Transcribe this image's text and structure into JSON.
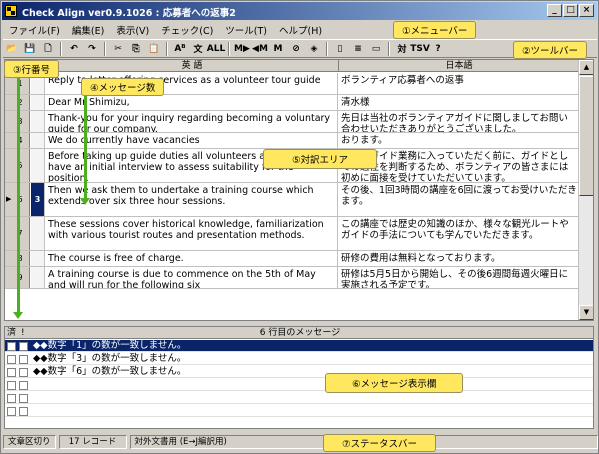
{
  "window": {
    "title": "Check Align ver0.9.1026 : 応募者への返事2",
    "minimize": "_",
    "maximize": "□",
    "close": "×"
  },
  "menu": [
    "ファイル(F)",
    "編集(E)",
    "表示(V)",
    "チェック(C)",
    "ツール(T)",
    "ヘルプ(H)"
  ],
  "toolbar": {
    "icons": [
      "open-icon",
      "save-icon",
      "new-icon",
      "undo-icon",
      "redo-icon",
      "cut-icon",
      "copy-icon",
      "paste-icon",
      "font-icon",
      "text-icon",
      "check-all-icon",
      "next-msg-icon",
      "prev-msg-icon",
      "msg-icon",
      "delete-msg-icon",
      "highlight-icon",
      "split-icon",
      "merge-icon",
      "line-icon",
      "parallel-icon",
      "tsv-icon",
      "help-icon"
    ],
    "glyphs": [
      "📂",
      "💾",
      "🗋",
      "↶",
      "↷",
      "✂",
      "⎘",
      "📋",
      "Aᴮ",
      "文",
      "ALL",
      "M▶",
      "◀M",
      "M",
      "⊘",
      "◈",
      "▯",
      "≡",
      "▭",
      "対",
      "TSV",
      "?"
    ]
  },
  "callouts": {
    "menubar": "①メニューバー",
    "toolbar": "②ツールバー",
    "line_number": "③行番号",
    "message_count": "④メッセージ数",
    "translation_area": "⑤対訳エリア",
    "message_area": "⑥メッセージ表示欄",
    "status_bar": "⑦ステータスバー"
  },
  "grid": {
    "col_en": "英 語",
    "col_ja": "日本語",
    "rows": [
      {
        "num": "1",
        "msg": "",
        "en": "Reply to letter offering services as a volunteer tour guide",
        "ja": "ボランティア応募者への返事"
      },
      {
        "num": "2",
        "msg": "",
        "en": "Dear Mr Shimizu,",
        "ja": "清水様"
      },
      {
        "num": "3",
        "msg": "",
        "en": "Thank-you for your inquiry regarding becoming a voluntary guide for our company.",
        "ja": "先日は当社のボランティアガイドに関しましてお問い合わせいただきありがとうございました。"
      },
      {
        "num": "4",
        "msg": "",
        "en": "We do currently have vacancies",
        "ja": "おります。"
      },
      {
        "num": "5",
        "msg": "",
        "en": "Before taking up guide duties all volunteers are required to have an initial interview to assess suitability for the position.",
        "ja": "実際のガイド業務に入っていただく前に、ガイドとしての適性を判断するため、ボランティアの皆さまには初めに面接を受けていただいています。"
      },
      {
        "num": "6",
        "msg": "3",
        "en": "Then we ask them to undertake a training course which extends over six three hour sessions.",
        "ja": "その後、1回3時間の講座を6回に渡ってお受けいただきます。"
      },
      {
        "num": "7",
        "msg": "",
        "en": "These sessions cover historical knowledge, familiarization with various tourist routes and presentation methods.",
        "ja": "この講座では歴史の知識のほか、様々な観光ルートやガイドの手法についても学んでいただきます。"
      },
      {
        "num": "8",
        "msg": "",
        "en": "The course is free of charge.",
        "ja": "研修の費用は無料となっております。"
      },
      {
        "num": "9",
        "msg": "",
        "en": "A training course is due to commence on the 5th of May and will run for the following six",
        "ja": "研修は5月5日から開始し、その後6週間毎週火曜日に実施される予定です。"
      }
    ]
  },
  "messages": {
    "header_done": "済",
    "header_flag": "!",
    "title": "6 行目のメッセージ",
    "rows": [
      "◆◆数字「1」の数が一致しません。",
      "◆◆数字「3」の数が一致しません。",
      "◆◆数字「6」の数が一致しません。",
      "",
      "",
      ""
    ]
  },
  "status": {
    "segment": "文章区切り",
    "records": "17 レコード",
    "mode": "対外文書用 (E→J編訳用)"
  }
}
